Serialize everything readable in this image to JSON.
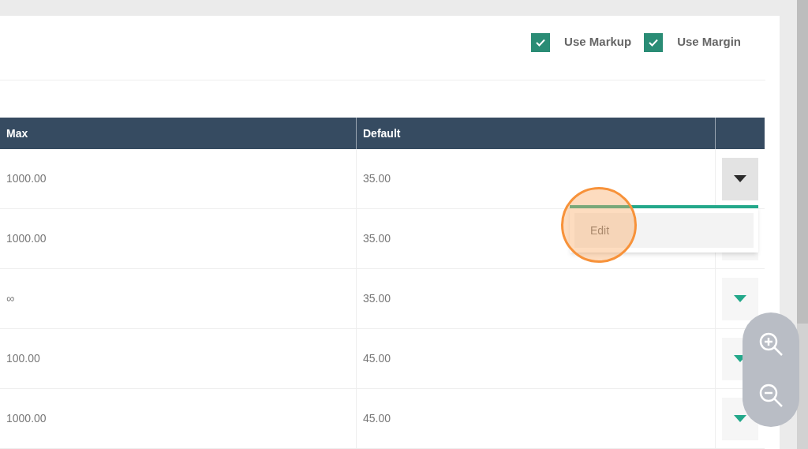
{
  "options": [
    {
      "label": "Use Markup",
      "checked": true
    },
    {
      "label": "Use Margin",
      "checked": true
    }
  ],
  "table": {
    "columns": [
      "Max",
      "Default"
    ],
    "rows": [
      {
        "cells": [
          "1000.00",
          "35.00"
        ],
        "menu_open": true
      },
      {
        "cells": [
          "1000.00",
          "35.00"
        ],
        "menu_open": false
      },
      {
        "cells": [
          "∞",
          "35.00"
        ],
        "menu_open": false
      },
      {
        "cells": [
          "100.00",
          "45.00"
        ],
        "menu_open": false
      },
      {
        "cells": [
          "1000.00",
          "45.00"
        ],
        "menu_open": false
      }
    ]
  },
  "row_menu": {
    "items": [
      "Edit"
    ]
  }
}
